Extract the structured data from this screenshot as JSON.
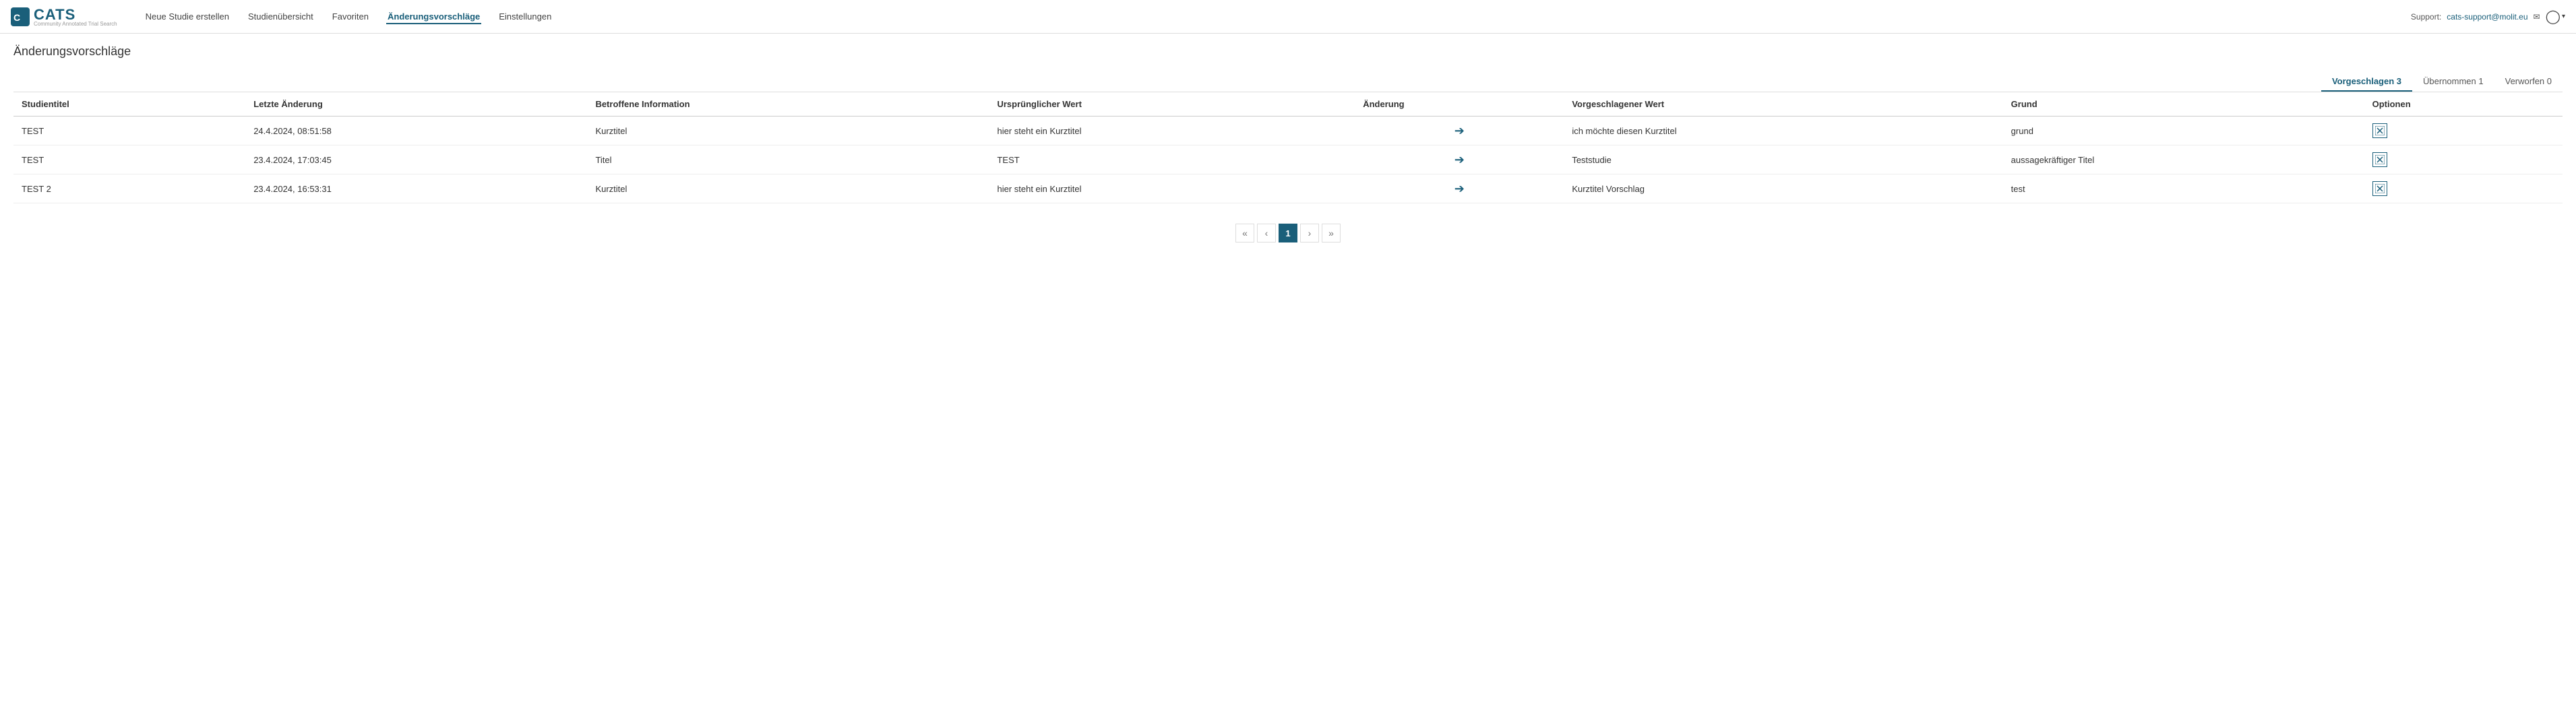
{
  "brand": {
    "logo_text": "CATS",
    "logo_sub": "Community Annotated Trial Search"
  },
  "nav": {
    "items": [
      {
        "label": "Neue Studie erstellen",
        "active": false
      },
      {
        "label": "Studienübersicht",
        "active": false
      },
      {
        "label": "Favoriten",
        "active": false
      },
      {
        "label": "Änderungsvorschläge",
        "active": true
      },
      {
        "label": "Einstellungen",
        "active": false
      }
    ]
  },
  "support": {
    "label": "Support:",
    "email": "cats-support@molit.eu",
    "email_icon": "✉"
  },
  "page": {
    "title": "Änderungsvorschläge"
  },
  "tabs": [
    {
      "label": "Vorgeschlagen 3",
      "active": true
    },
    {
      "label": "Übernommen 1",
      "active": false
    },
    {
      "label": "Verworfen 0",
      "active": false
    }
  ],
  "table": {
    "headers": [
      "Studientitel",
      "Letzte Änderung",
      "Betroffene Information",
      "Ursprünglicher Wert",
      "Änderung",
      "Vorgeschlagener Wert",
      "Grund",
      "Optionen"
    ],
    "rows": [
      {
        "studientitel": "TEST",
        "letzte_aenderung": "24.4.2024, 08:51:58",
        "betroffene_info": "Kurztitel",
        "urspruenglicher_wert": "hier steht ein Kurztitel",
        "aenderung_arrow": "→",
        "vorgeschlagener_wert": "ich möchte diesen Kurztitel",
        "grund": "grund"
      },
      {
        "studientitel": "TEST",
        "letzte_aenderung": "23.4.2024, 17:03:45",
        "betroffene_info": "Titel",
        "urspruenglicher_wert": "TEST",
        "aenderung_arrow": "→",
        "vorgeschlagener_wert": "Teststudie",
        "grund": "aussagekräftiger Titel"
      },
      {
        "studientitel": "TEST 2",
        "letzte_aenderung": "23.4.2024, 16:53:31",
        "betroffene_info": "Kurztitel",
        "urspruenglicher_wert": "hier steht ein Kurztitel",
        "aenderung_arrow": "→",
        "vorgeschlagener_wert": "Kurztitel Vorschlag",
        "grund": "test"
      }
    ]
  },
  "pagination": {
    "first": "«",
    "prev": "‹",
    "pages": [
      "1"
    ],
    "next": "›",
    "last": "»",
    "current": "1"
  }
}
